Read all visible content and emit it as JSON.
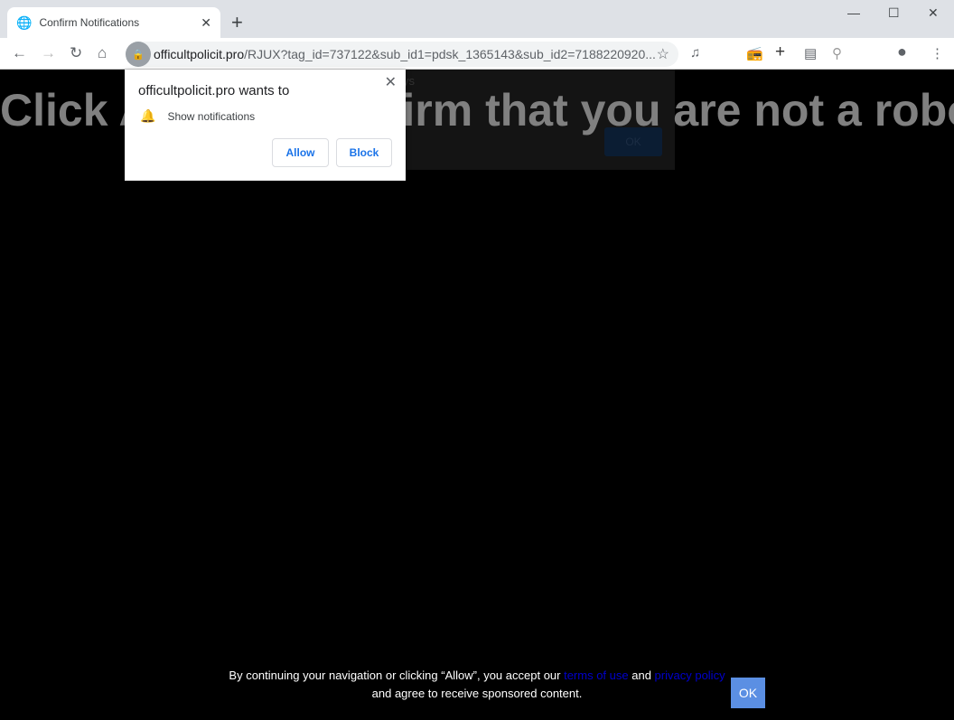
{
  "browser": {
    "tab_title": "Confirm Notifications",
    "url_domain": "officultpolicit.pro",
    "url_rest": "/RJUX?tag_id=737122&sub_id1=pdsk_1365143&sub_id2=7188220920..."
  },
  "page": {
    "heading": "Click Allow to confirm that you are not a robot!",
    "background_dialog": {
      "text": "ys",
      "ok_label": "OK"
    },
    "footer": {
      "text1": "By continuing your navigation or clicking “Allow”, you accept our ",
      "terms_link": "terms of use",
      "and": " and ",
      "privacy_link": "privacy policy",
      "text2": "and agree to receive sponsored content.",
      "ok_label": "OK"
    }
  },
  "permission_prompt": {
    "title": "officultpolicit.pro wants to",
    "permission": "Show notifications",
    "allow_label": "Allow",
    "block_label": "Block"
  },
  "colors": {
    "accent": "#1a73e8",
    "ok_button": "#5b8fe3",
    "link": "#0000cc"
  }
}
